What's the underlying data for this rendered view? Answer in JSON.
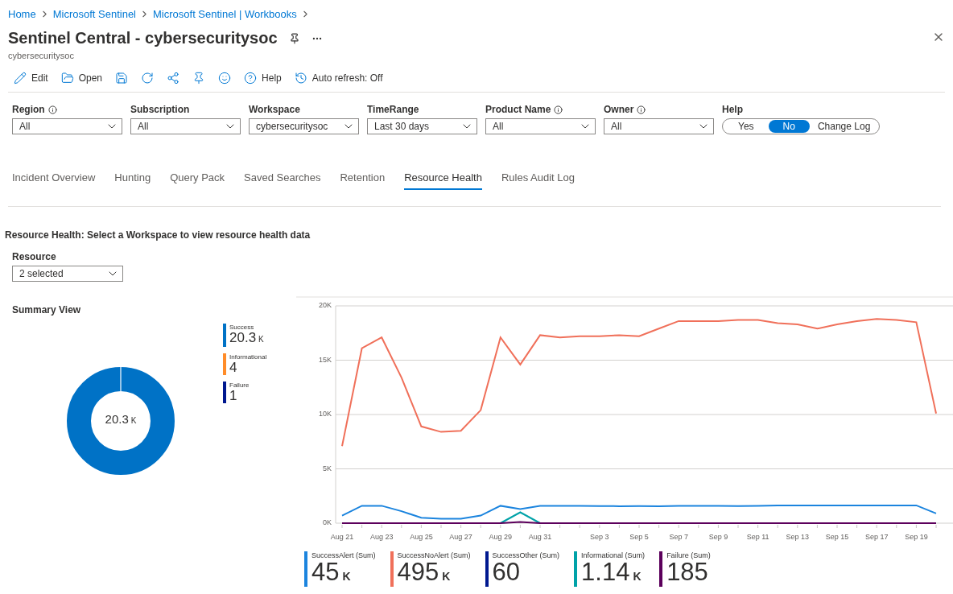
{
  "breadcrumb": [
    "Home",
    "Microsoft Sentinel",
    "Microsoft Sentinel | Workbooks"
  ],
  "title": "Sentinel Central - cybersecuritysoc",
  "subtitle": "cybersecuritysoc",
  "toolbar": [
    {
      "kind": "edit",
      "label": "Edit"
    },
    {
      "kind": "open",
      "label": "Open"
    },
    {
      "kind": "save"
    },
    {
      "kind": "refresh"
    },
    {
      "kind": "share"
    },
    {
      "kind": "pin"
    },
    {
      "kind": "feedback"
    },
    {
      "kind": "help",
      "label": "Help"
    },
    {
      "kind": "autorefresh",
      "label": "Auto refresh: Off"
    }
  ],
  "parameters": [
    {
      "label": "Region",
      "info": true,
      "value": "All"
    },
    {
      "label": "Subscription",
      "info": false,
      "value": "All"
    },
    {
      "label": "Workspace",
      "info": false,
      "value": "cybersecuritysoc"
    },
    {
      "label": "TimeRange",
      "info": false,
      "value": "Last 30 days"
    },
    {
      "label": "Product Name",
      "info": true,
      "value": "All"
    },
    {
      "label": "Owner",
      "info": true,
      "value": "All"
    }
  ],
  "help": {
    "label": "Help",
    "options": [
      {
        "label": "Yes",
        "selected": false
      },
      {
        "label": "No",
        "selected": true
      },
      {
        "label": "Change Log",
        "selected": false
      }
    ]
  },
  "tabs": [
    {
      "label": "Incident Overview",
      "selected": false
    },
    {
      "label": "Hunting",
      "selected": false
    },
    {
      "label": "Query Pack",
      "selected": false
    },
    {
      "label": "Saved Searches",
      "selected": false
    },
    {
      "label": "Retention",
      "selected": false
    },
    {
      "label": "Resource Health",
      "selected": true
    },
    {
      "label": "Rules Audit Log",
      "selected": false
    }
  ],
  "section_title": "Resource Health: Select a Workspace to view resource health data",
  "resource": {
    "label": "Resource",
    "value": "2 selected"
  },
  "summary": {
    "title": "Summary View",
    "center_value": "20.3",
    "center_unit": "K",
    "legend": [
      {
        "name": "Success",
        "value": "20.3",
        "unit": "K",
        "color": "#0072c6"
      },
      {
        "name": "Informational",
        "value": "4",
        "color": "#ff8c29"
      },
      {
        "name": "Failure",
        "value": "1",
        "color": "#00188f"
      }
    ]
  },
  "timeline": {
    "chart_data": {
      "type": "line",
      "categories": [
        "Aug 21",
        null,
        "Aug 23",
        null,
        "Aug 25",
        null,
        "Aug 27",
        null,
        "Aug 29",
        null,
        "Aug 31",
        null,
        null,
        "Sep 3",
        null,
        "Sep 5",
        null,
        "Sep 7",
        null,
        "Sep 9",
        null,
        "Sep 11",
        null,
        "Sep 13",
        null,
        "Sep 15",
        null,
        "Sep 17",
        null,
        "Sep 19",
        null
      ],
      "ylim": [
        0,
        20000
      ],
      "grid": true,
      "yticks": [
        {
          "value": 0,
          "label": "0K"
        },
        {
          "value": 5000,
          "label": "5K"
        },
        {
          "value": 10000,
          "label": "10K"
        },
        {
          "value": 15000,
          "label": "15K"
        },
        {
          "value": 20000,
          "label": "20K"
        }
      ],
      "series": [
        {
          "name": "SuccessAlert (Sum)",
          "color": "#1b84de",
          "values": [
            700,
            1600,
            1600,
            1100,
            500,
            400,
            400,
            700,
            1600,
            1300,
            1600,
            1600,
            1600,
            1580,
            1560,
            1580,
            1560,
            1600,
            1600,
            1600,
            1580,
            1600,
            1620,
            1620,
            1640,
            1640,
            1620,
            1620,
            1620,
            1640,
            900
          ]
        },
        {
          "name": "SuccessNoAlert (Sum)",
          "color": "#f0705a",
          "values": [
            7100,
            16100,
            17100,
            13400,
            8900,
            8400,
            8500,
            10400,
            17100,
            14600,
            17300,
            17100,
            17200,
            17200,
            17300,
            17200,
            17900,
            18600,
            18600,
            18600,
            18700,
            18700,
            18400,
            18300,
            17900,
            18300,
            18600,
            18800,
            18700,
            18500,
            10100
          ]
        },
        {
          "name": "SuccessOther (Sum)",
          "color": "#00188f",
          "values": [
            null,
            null,
            null,
            null,
            null,
            null,
            null,
            null,
            null,
            null,
            null,
            null,
            null,
            null,
            null,
            null,
            null,
            null,
            null,
            null,
            null,
            null,
            null,
            null,
            null,
            null,
            null,
            null,
            null,
            null,
            null
          ]
        },
        {
          "name": "Informational (Sum)",
          "color": "#00a2a8",
          "values": [
            null,
            null,
            null,
            null,
            null,
            null,
            null,
            null,
            0,
            1000,
            0,
            null,
            null,
            null,
            null,
            null,
            null,
            null,
            null,
            null,
            null,
            null,
            null,
            null,
            null,
            null,
            null,
            null,
            null,
            null,
            null
          ]
        },
        {
          "name": "Failure (Sum)",
          "color": "#5c005c",
          "values": [
            0,
            0,
            0,
            0,
            0,
            0,
            0,
            0,
            0,
            100,
            0,
            0,
            0,
            0,
            0,
            0,
            0,
            0,
            0,
            0,
            0,
            0,
            0,
            0,
            0,
            0,
            0,
            0,
            0,
            0,
            0
          ]
        }
      ]
    },
    "totals": [
      {
        "value": "45",
        "unit": "K"
      },
      {
        "value": "495",
        "unit": "K"
      },
      {
        "value": "60"
      },
      {
        "value": "1.14",
        "unit": "K"
      },
      {
        "value": "185"
      }
    ]
  }
}
